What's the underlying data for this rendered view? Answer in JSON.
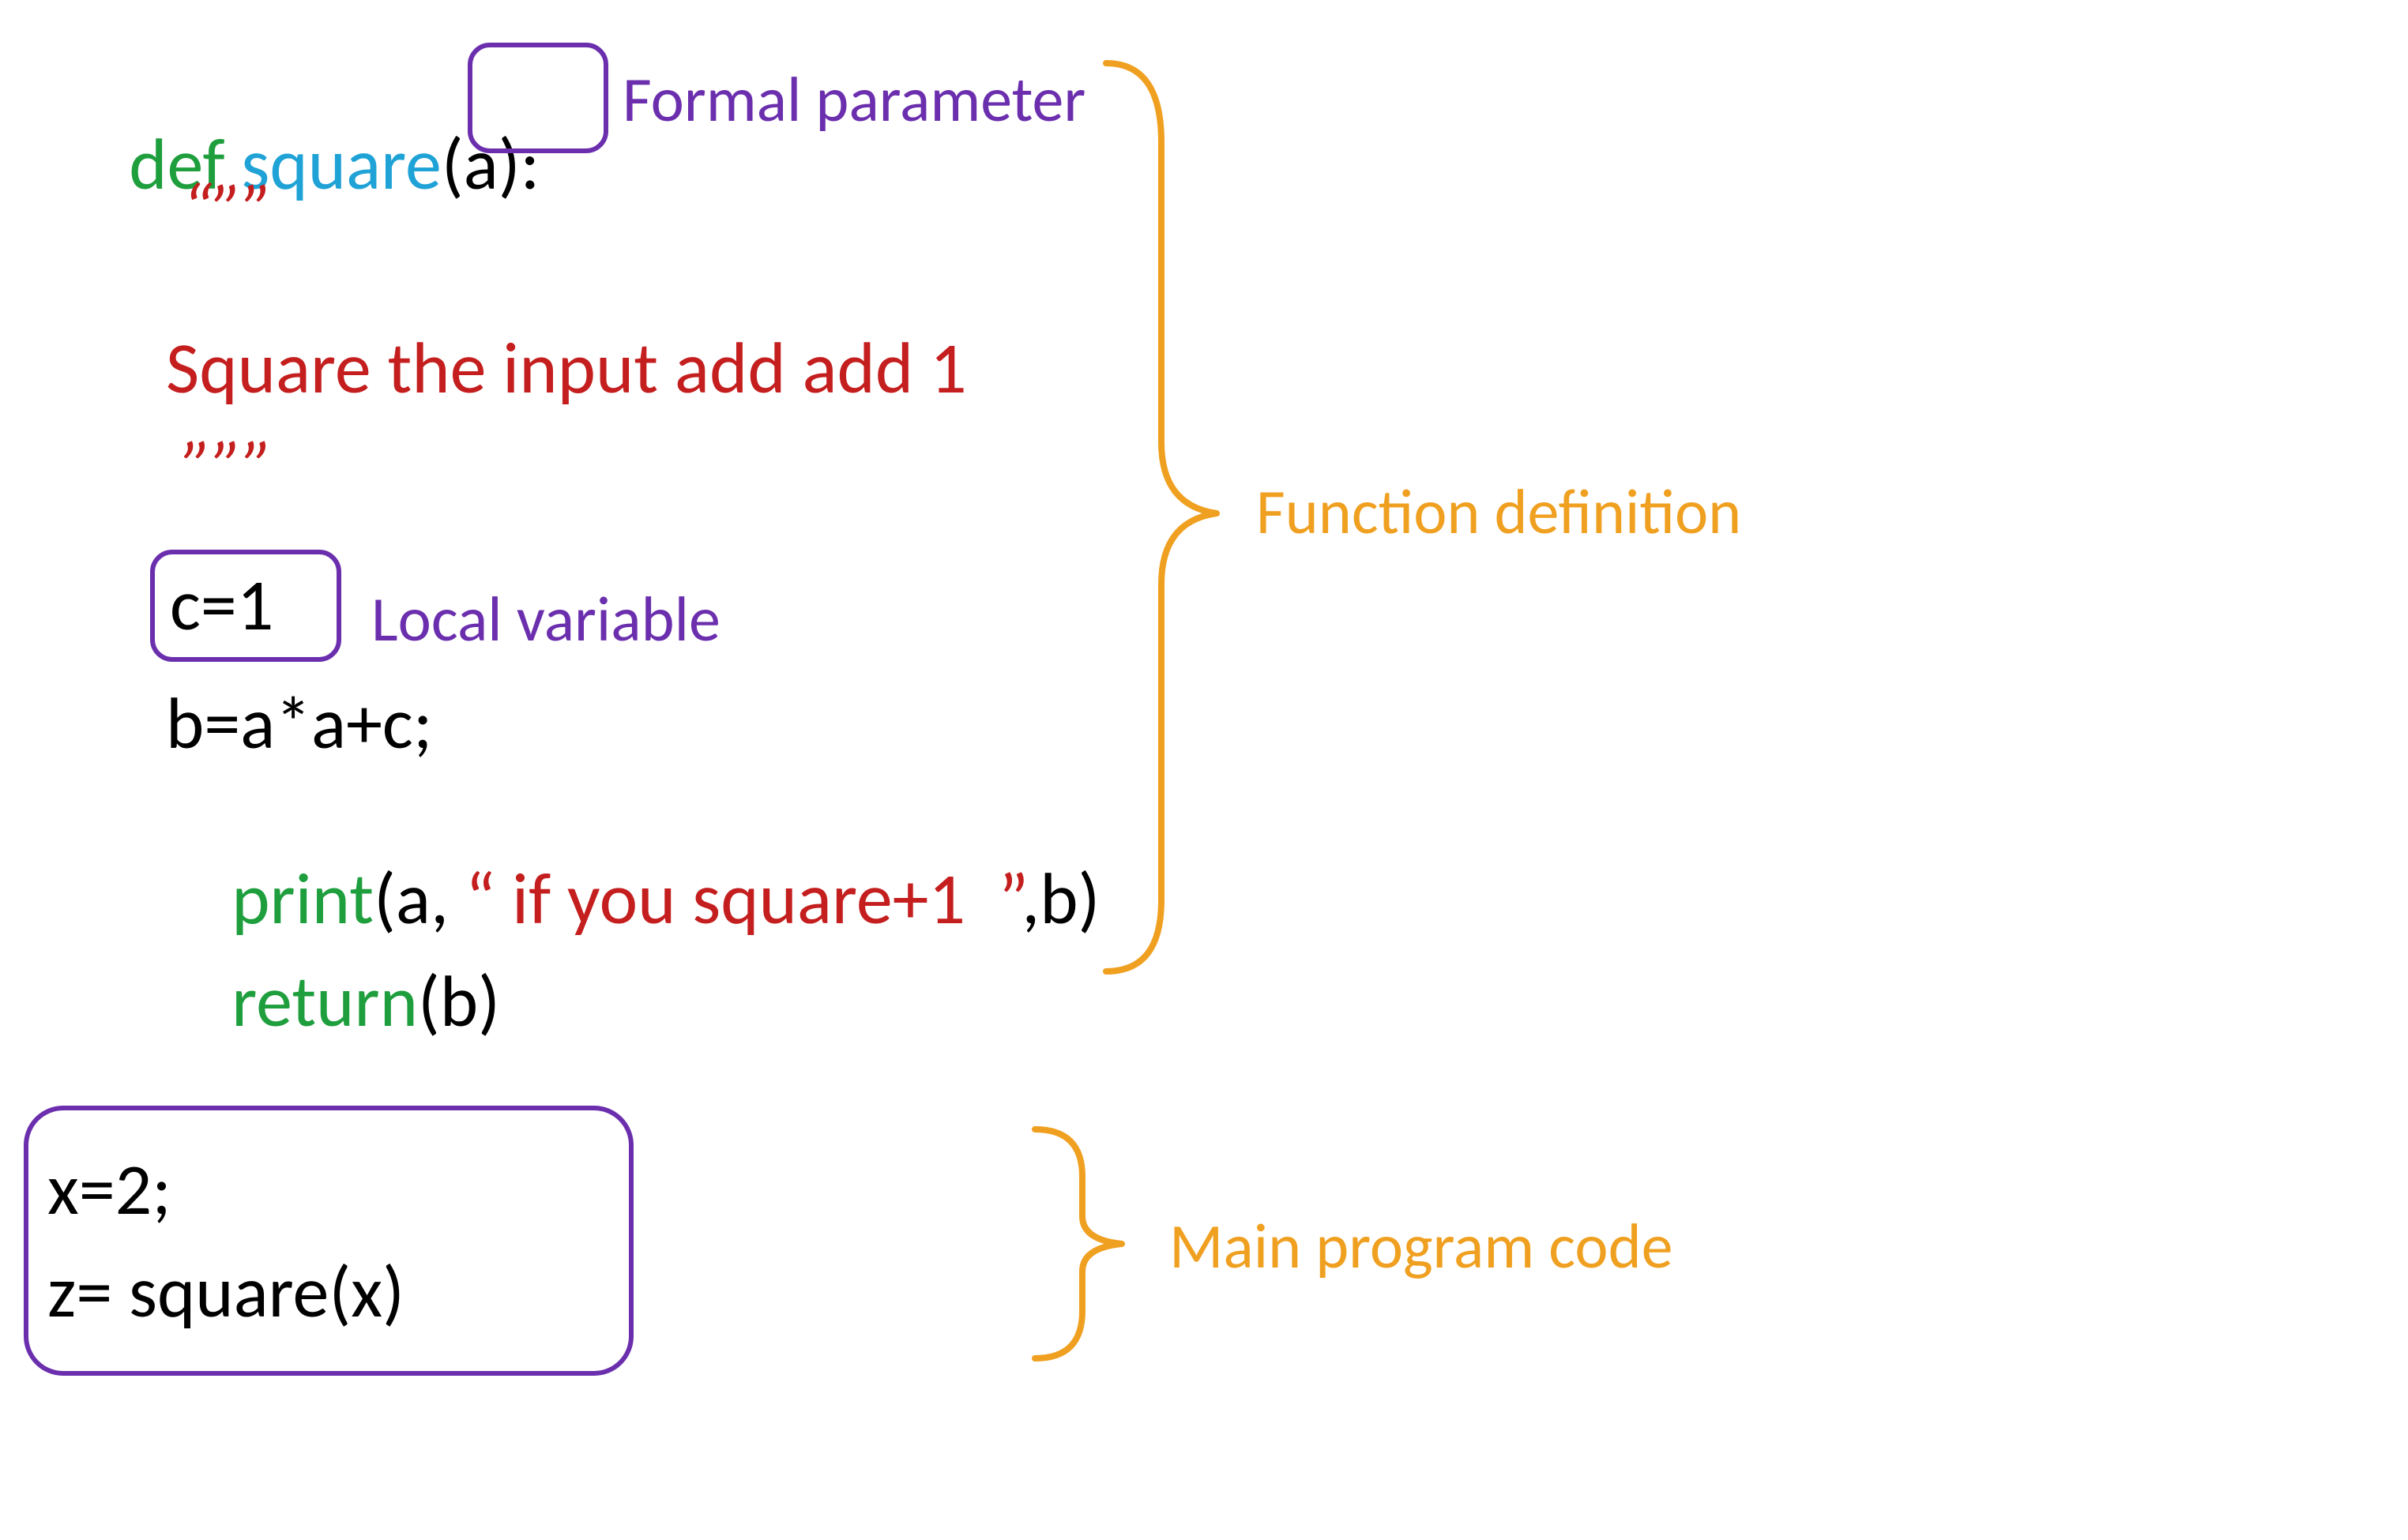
{
  "code": {
    "line1": {
      "def": "def ",
      "name": "square",
      "params": "(a)",
      "colon": ":"
    },
    "docOpen": "“””",
    "docText": "Square the input add add 1",
    "docClose": "”””",
    "c_assign": "c=1",
    "b_assign": "b=a*a+c;",
    "print": {
      "kw": "print",
      "open": "(a, ",
      "str": "“ if you square+1  ”",
      "close": ",b)"
    },
    "ret": {
      "kw": "return",
      "arg": "(b)"
    },
    "main1": "x=2;",
    "main2": "z= square(x)"
  },
  "labels": {
    "formalParam": "Formal parameter",
    "localVar": "Local variable",
    "funcDef": "Function definition",
    "mainProg": "Main program code"
  }
}
